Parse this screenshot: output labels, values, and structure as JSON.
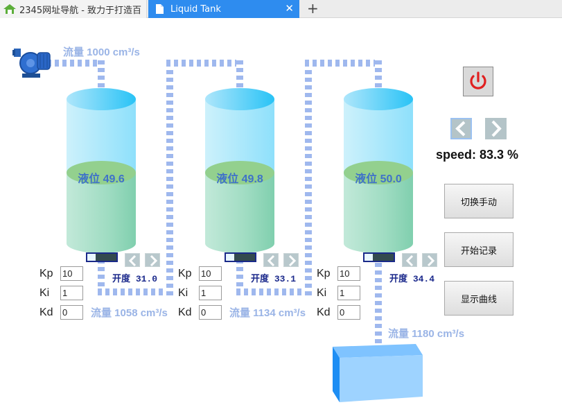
{
  "tabs": [
    {
      "label": "2345网址导航 - 致力于打造百"
    },
    {
      "label": "Liquid Tank"
    }
  ],
  "new_tab_symbol": "+",
  "close_symbol": "✕",
  "flows": {
    "inlet": "流量 1000 cm³/s",
    "tank1_out": "流量 1058 cm³/s",
    "tank2_out": "流量 1134 cm³/s",
    "tank3_out": "流量 1180 cm³/s"
  },
  "tanks": [
    {
      "level_label": "液位 49.6",
      "level": 49.6,
      "opening_label": "开度",
      "opening_value": "31.0",
      "opening": 31.0,
      "kp": "10",
      "ki": "1",
      "kd": "0"
    },
    {
      "level_label": "液位 49.8",
      "level": 49.8,
      "opening_label": "开度",
      "opening_value": "33.1",
      "opening": 33.1,
      "kp": "10",
      "ki": "1",
      "kd": "0"
    },
    {
      "level_label": "液位 50.0",
      "level": 50.0,
      "opening_label": "开度",
      "opening_value": "34.4",
      "opening": 34.4,
      "kp": "10",
      "ki": "1",
      "kd": "0"
    }
  ],
  "pid_labels": {
    "kp": "Kp",
    "ki": "Ki",
    "kd": "Kd"
  },
  "speed_text": "speed: 83.3 %",
  "speed": 83.3,
  "buttons": {
    "manual": "切换手动",
    "record": "开始记录",
    "curve": "显示曲线"
  },
  "icons": {
    "power": "power-icon",
    "prev": "chevron-left-icon",
    "next": "chevron-right-icon",
    "pump": "pump-icon"
  },
  "colors": {
    "pipe": "#9fb8ee",
    "flow_text": "#9ab4e6",
    "level_text": "#3f72c9",
    "tab_active": "#2e8cef",
    "power_red": "#e02020"
  }
}
